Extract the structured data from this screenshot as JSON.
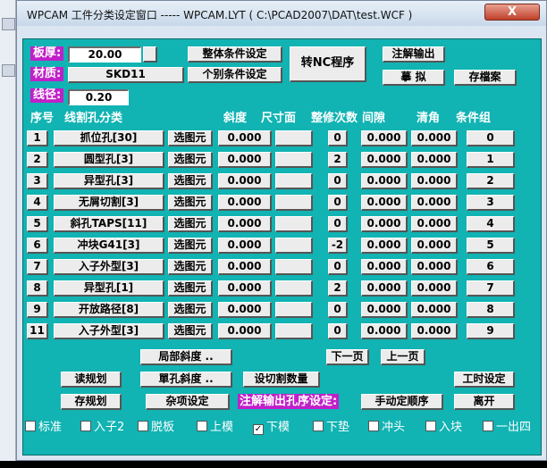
{
  "window": {
    "title": "WPCAM 工件分类设定窗口 ----- WPCAM.LYT ( C:\\PCAD2007\\DAT\\test.WCF )",
    "close_label": "X"
  },
  "params": {
    "thickness_label": "板厚:",
    "thickness_value": "20.00",
    "material_label": "材质:",
    "material_value": "SKD11",
    "wire_label": "线径:",
    "wire_value": "0.20"
  },
  "top_buttons": {
    "global_condition": "整体条件设定",
    "individual_condition": "个别条件设定",
    "to_nc": "转NC程序",
    "annotate_output": "注解输出",
    "simulate": "摹  拟",
    "save_file": "存檔案"
  },
  "columns": {
    "no": "序号",
    "category": "线割孔分类",
    "taper": "斜度",
    "dimension": "尺寸面",
    "trim_count": "整修次数",
    "gap": "间隙",
    "corner": "清角",
    "condition_group": "条件组"
  },
  "rows": [
    {
      "no": "1",
      "name": "抓位孔[30]",
      "select": "选图元",
      "taper": "0.000",
      "trim": "0",
      "gap": "0.000",
      "corner": "0.000",
      "group": "0"
    },
    {
      "no": "2",
      "name": "圆型孔[3]",
      "select": "选图元",
      "taper": "0.000",
      "trim": "2",
      "gap": "0.000",
      "corner": "0.000",
      "group": "1"
    },
    {
      "no": "3",
      "name": "异型孔[3]",
      "select": "选图元",
      "taper": "0.000",
      "trim": "0",
      "gap": "0.000",
      "corner": "0.000",
      "group": "2"
    },
    {
      "no": "4",
      "name": "无屑切割[3]",
      "select": "选图元",
      "taper": "0.000",
      "trim": "0",
      "gap": "0.000",
      "corner": "0.000",
      "group": "3"
    },
    {
      "no": "5",
      "name": "斜孔TAPS[11]",
      "select": "选图元",
      "taper": "0.000",
      "trim": "0",
      "gap": "0.000",
      "corner": "0.000",
      "group": "4"
    },
    {
      "no": "6",
      "name": "冲块G41[3]",
      "select": "选图元",
      "taper": "0.000",
      "trim": "-2",
      "gap": "0.000",
      "corner": "0.000",
      "group": "5"
    },
    {
      "no": "7",
      "name": "入子外型[3]",
      "select": "选图元",
      "taper": "0.000",
      "trim": "0",
      "gap": "0.000",
      "corner": "0.000",
      "group": "6"
    },
    {
      "no": "8",
      "name": "异型孔[1]",
      "select": "选图元",
      "taper": "0.000",
      "trim": "2",
      "gap": "0.000",
      "corner": "0.000",
      "group": "7"
    },
    {
      "no": "9",
      "name": "开放路径[8]",
      "select": "选图元",
      "taper": "0.000",
      "trim": "0",
      "gap": "0.000",
      "corner": "0.000",
      "group": "8"
    },
    {
      "no": "11",
      "name": "入子外型[3]",
      "select": "选图元",
      "taper": "0.000",
      "trim": "0",
      "gap": "0.000",
      "corner": "0.000",
      "group": "9"
    }
  ],
  "bottom_buttons": {
    "local_taper": "局部斜度 ..",
    "next_page": "下一页",
    "prev_page": "上一页",
    "read_plan": "读规划",
    "single_taper": "單孔斜度 ..",
    "set_cut_count": "设切割数量",
    "work_hours": "工时设定",
    "save_plan": "存规划",
    "misc_settings": "杂项设定",
    "annotate_order_note": "注解输出孔序设定:",
    "manual_order": "手动定顺序",
    "exit": "离开"
  },
  "checkboxes": [
    {
      "label": "标准",
      "checked": false
    },
    {
      "label": "入子2",
      "checked": false
    },
    {
      "label": "脱板",
      "checked": false
    },
    {
      "label": "上模",
      "checked": false
    },
    {
      "label": "下模",
      "checked": true
    },
    {
      "label": "下垫",
      "checked": false
    },
    {
      "label": "冲头",
      "checked": false
    },
    {
      "label": "入块",
      "checked": false
    },
    {
      "label": "一出四",
      "checked": false
    }
  ],
  "colors": {
    "client_bg": "#11b3b3",
    "label_highlight": "#c020c8"
  }
}
